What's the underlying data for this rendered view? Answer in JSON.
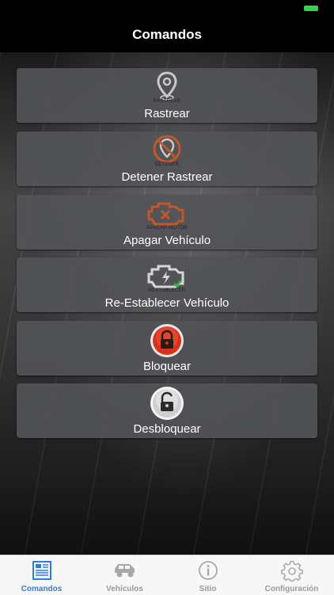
{
  "nav": {
    "title": "Comandos"
  },
  "commands": [
    {
      "label": "Rastrear",
      "icon": "location-pin-icon",
      "caption": "RASTREAR"
    },
    {
      "label": "Detener Rastrear",
      "icon": "stop-location-icon",
      "caption": "DETENER"
    },
    {
      "label": "Apagar Vehículo",
      "icon": "engine-off-icon",
      "caption": "APAGAR MOTOR"
    },
    {
      "label": "Re-Establecer Vehículo",
      "icon": "engine-restore-icon",
      "caption": "RESTABLECER"
    },
    {
      "label": "Bloquear",
      "icon": "lock-icon"
    },
    {
      "label": "Desbloquear",
      "icon": "unlock-icon"
    }
  ],
  "tabs": [
    {
      "label": "Comandos",
      "icon": "document-icon",
      "active": true
    },
    {
      "label": "Vehículos",
      "icon": "car-icon",
      "active": false
    },
    {
      "label": "Sitio",
      "icon": "info-icon",
      "active": false
    },
    {
      "label": "Configuración",
      "icon": "gear-icon",
      "active": false
    }
  ],
  "colors": {
    "accent": "#2f7de0",
    "stop": "#c2582a",
    "lock": "#d8321e",
    "battery": "#2fd44a"
  }
}
